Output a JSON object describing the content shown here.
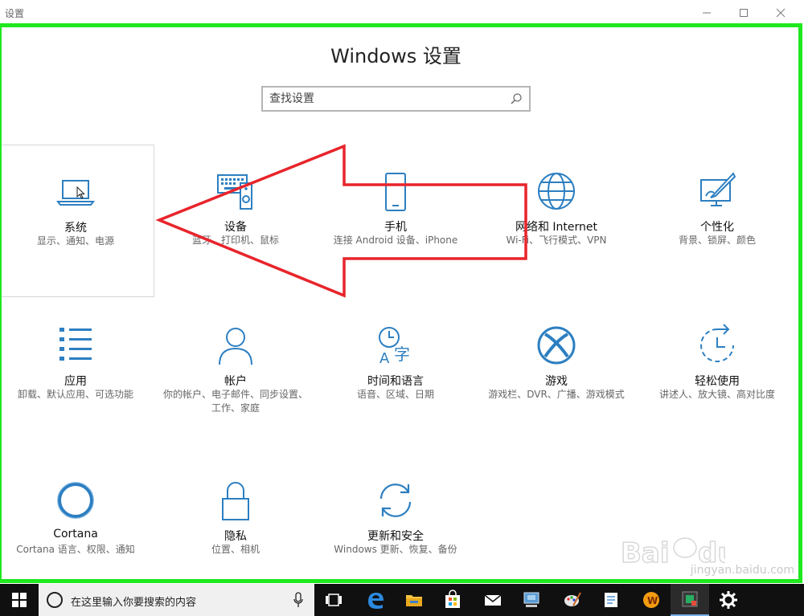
{
  "window": {
    "title": "设置",
    "minimize_icon": "minimize-icon",
    "maximize_icon": "maximize-icon",
    "close_icon": "close-icon"
  },
  "header": {
    "title": "Windows 设置"
  },
  "search": {
    "placeholder": "查找设置",
    "icon": "search-icon"
  },
  "tiles": [
    {
      "name": "系统",
      "desc": "显示、通知、电源",
      "icon": "laptop-icon"
    },
    {
      "name": "设备",
      "desc": "蓝牙、打印机、鼠标",
      "icon": "devices-icon"
    },
    {
      "name": "手机",
      "desc": "连接 Android 设备、iPhone",
      "icon": "phone-icon"
    },
    {
      "name": "网络和 Internet",
      "desc": "Wi-Fi、飞行模式、VPN",
      "icon": "globe-icon"
    },
    {
      "name": "个性化",
      "desc": "背景、锁屏、颜色",
      "icon": "personalization-icon"
    },
    {
      "name": "应用",
      "desc": "卸载、默认应用、可选功能",
      "icon": "apps-list-icon"
    },
    {
      "name": "帐户",
      "desc": "你的帐户、电子邮件、同步设置、工作、家庭",
      "icon": "person-icon"
    },
    {
      "name": "时间和语言",
      "desc": "语音、区域、日期",
      "icon": "time-language-icon"
    },
    {
      "name": "游戏",
      "desc": "游戏栏、DVR、广播、游戏模式",
      "icon": "xbox-icon"
    },
    {
      "name": "轻松使用",
      "desc": "讲述人、放大镜、高对比度",
      "icon": "ease-of-access-icon"
    },
    {
      "name": "Cortana",
      "desc": "Cortana 语言、权限、通知",
      "icon": "cortana-icon"
    },
    {
      "name": "隐私",
      "desc": "位置、相机",
      "icon": "lock-icon"
    },
    {
      "name": "更新和安全",
      "desc": "Windows 更新、恢复、备份",
      "icon": "sync-icon"
    }
  ],
  "taskbar": {
    "search_placeholder": "在这里输入你要搜索的内容",
    "icons": [
      "windows-start-icon",
      "task-view-icon",
      "edge-icon",
      "file-explorer-icon",
      "store-icon",
      "mail-icon",
      "pc-icon",
      "paint-icon",
      "notepad-icon",
      "game-icon",
      "app-icon",
      "settings-gear-icon"
    ]
  },
  "watermark": {
    "text": "jingyan.baidu.com",
    "brand": "Baidu 经验"
  },
  "colors": {
    "accent": "#2d7fc1",
    "annotation_green": "#1ee81e",
    "annotation_red": "#e8242b",
    "taskbar": "#101010"
  }
}
